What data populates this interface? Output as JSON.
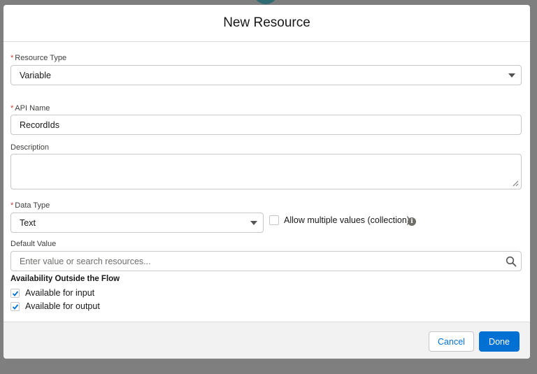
{
  "modal": {
    "title": "New Resource"
  },
  "form": {
    "resource_type": {
      "label": "Resource Type",
      "value": "Variable"
    },
    "api_name": {
      "label": "API Name",
      "value": "RecordIds"
    },
    "description": {
      "label": "Description",
      "value": ""
    },
    "data_type": {
      "label": "Data Type",
      "value": "Text"
    },
    "allow_multiple": {
      "label": "Allow multiple values (collection)",
      "checked": false
    },
    "default_value": {
      "label": "Default Value",
      "placeholder": "Enter value or search resources..."
    },
    "availability": {
      "heading": "Availability Outside the Flow",
      "input": {
        "label": "Available for input",
        "checked": true
      },
      "output": {
        "label": "Available for output",
        "checked": true
      }
    },
    "required_marker": "*"
  },
  "footer": {
    "cancel_label": "Cancel",
    "done_label": "Done"
  },
  "colors": {
    "brand": "#0070d2",
    "required": "#c23934",
    "overlay": "#7f7f7f"
  }
}
